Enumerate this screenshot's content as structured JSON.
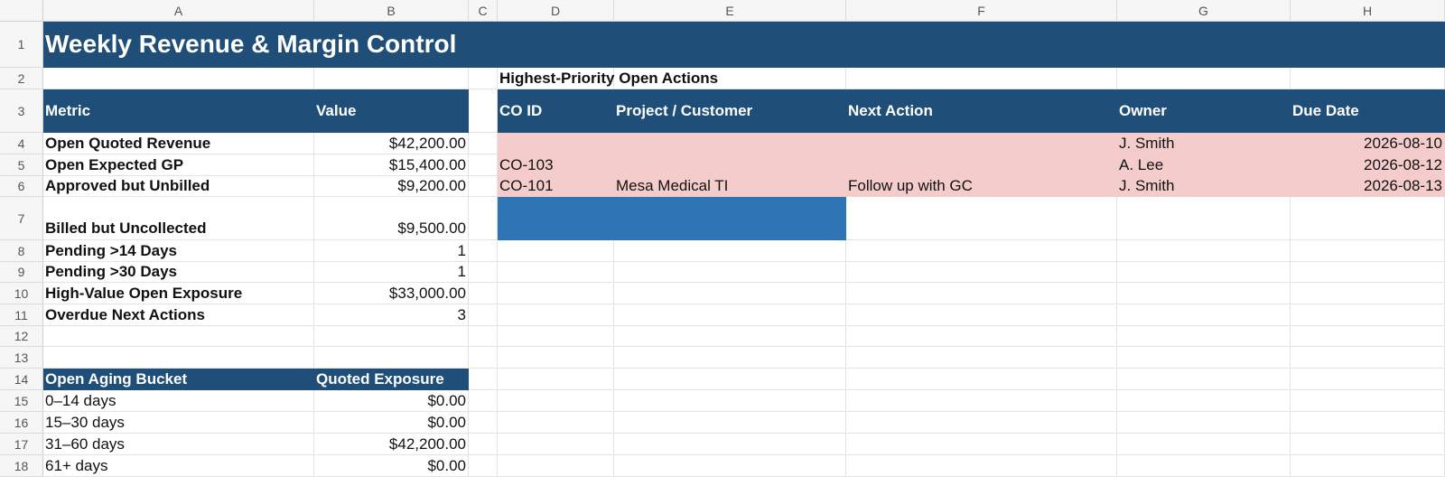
{
  "columns": [
    "A",
    "B",
    "C",
    "D",
    "E",
    "F",
    "G",
    "H"
  ],
  "rows": [
    "1",
    "2",
    "3",
    "4",
    "5",
    "6",
    "7",
    "8",
    "9",
    "10",
    "11",
    "12",
    "13",
    "14",
    "15",
    "16",
    "17",
    "18"
  ],
  "title": "Weekly Revenue & Margin Control",
  "metrics": {
    "header": {
      "metric": "Metric",
      "value": "Value"
    },
    "rows": [
      {
        "label": "Open Quoted Revenue",
        "value": "$42,200.00"
      },
      {
        "label": "Open Expected GP",
        "value": "$15,400.00"
      },
      {
        "label": "Approved but Unbilled",
        "value": "$9,200.00"
      },
      {
        "label": "Billed but Uncollected",
        "value": "$9,500.00"
      },
      {
        "label": "Pending >14 Days",
        "value": "1"
      },
      {
        "label": "Pending >30 Days",
        "value": "1"
      },
      {
        "label": "High-Value Open Exposure",
        "value": "$33,000.00"
      },
      {
        "label": "Overdue Next Actions",
        "value": "3"
      }
    ]
  },
  "aging": {
    "header": {
      "bucket": "Open Aging Bucket",
      "exposure": "Quoted Exposure"
    },
    "rows": [
      {
        "bucket": "0–14 days",
        "exposure": "$0.00"
      },
      {
        "bucket": "15–30 days",
        "exposure": "$0.00"
      },
      {
        "bucket": "31–60 days",
        "exposure": "$42,200.00"
      },
      {
        "bucket": "61+ days",
        "exposure": "$0.00"
      }
    ]
  },
  "actions": {
    "title": "Highest-Priority Open Actions",
    "headers": {
      "co_id": "CO ID",
      "project": "Project / Customer",
      "next_action": "Next Action",
      "owner": "Owner",
      "due_date": "Due Date"
    },
    "rows": [
      {
        "co_id": "",
        "project": "",
        "next_action": "",
        "owner": "J. Smith",
        "due_date": "2026-08-10"
      },
      {
        "co_id": "CO-103",
        "project": "",
        "next_action": "",
        "owner": "A. Lee",
        "due_date": "2026-08-12"
      },
      {
        "co_id": "CO-101",
        "project": "Mesa Medical TI",
        "next_action": "Follow up with GC",
        "owner": "J. Smith",
        "due_date": "2026-08-13"
      }
    ]
  },
  "colors": {
    "header_fill": "#1f4e79",
    "highlight_fill": "#f4cccc",
    "selection_fill": "#2e75b6"
  }
}
